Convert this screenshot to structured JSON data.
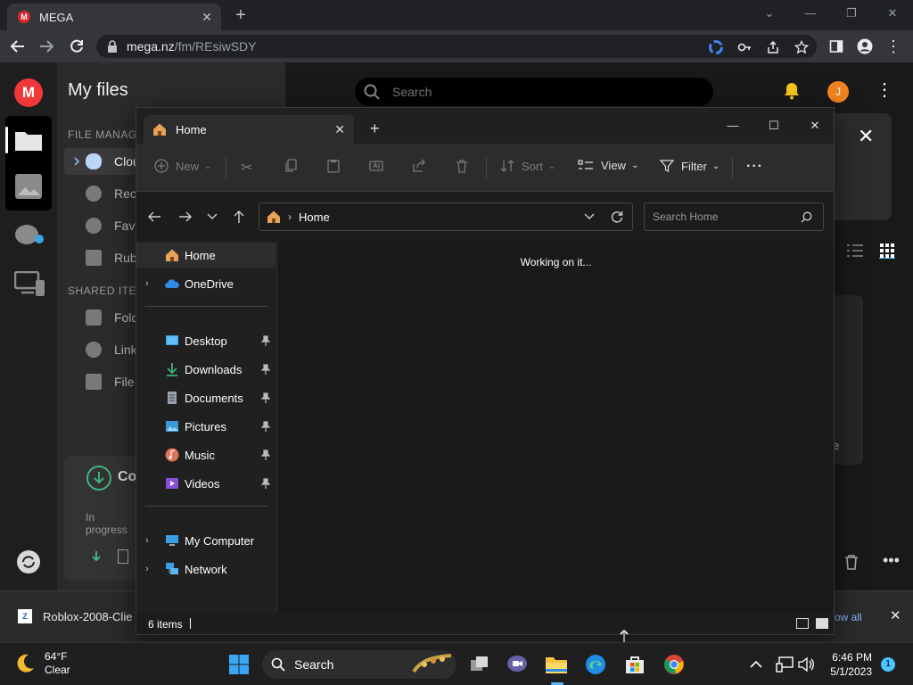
{
  "browser": {
    "tab_title": "MEGA",
    "url_host": "mega.nz",
    "url_path": "/fm/REsiwSDY"
  },
  "mega": {
    "page_title": "My files",
    "search_placeholder": "Search",
    "avatar_letter": "J",
    "sections": {
      "file_management": "FILE MANAGE",
      "shared_items": "SHARED ITEM"
    },
    "nav_items": [
      "Clou",
      "Rece",
      "Favo",
      "Rub",
      "Fold",
      "Link",
      "File"
    ],
    "transfer_title": "Co",
    "transfer_status": "In progress",
    "card_tail": "e"
  },
  "download_bar": {
    "file_name": "Roblox-2008-Clie",
    "show_all": "ow all"
  },
  "explorer": {
    "tab_title": "Home",
    "commands": {
      "new": "New",
      "sort": "Sort",
      "view": "View",
      "filter": "Filter"
    },
    "breadcrumb": "Home",
    "search_placeholder": "Search Home",
    "nav": [
      {
        "label": "Home"
      },
      {
        "label": "OneDrive"
      },
      {
        "label": "Desktop"
      },
      {
        "label": "Downloads"
      },
      {
        "label": "Documents"
      },
      {
        "label": "Pictures"
      },
      {
        "label": "Music"
      },
      {
        "label": "Videos"
      },
      {
        "label": "My Computer"
      },
      {
        "label": "Network"
      }
    ],
    "status_message": "Working on it...",
    "item_count": "6 items"
  },
  "taskbar": {
    "weather_temp": "64°F",
    "weather_desc": "Clear",
    "search_label": "Search",
    "time": "6:46 PM",
    "date": "5/1/2023",
    "notification_count": "1"
  },
  "colors": {
    "mega_red": "#f0373a",
    "avatar_orange": "#f0831f",
    "explorer_bg": "#1c1c1c",
    "accent_blue": "#4cc2ff"
  }
}
